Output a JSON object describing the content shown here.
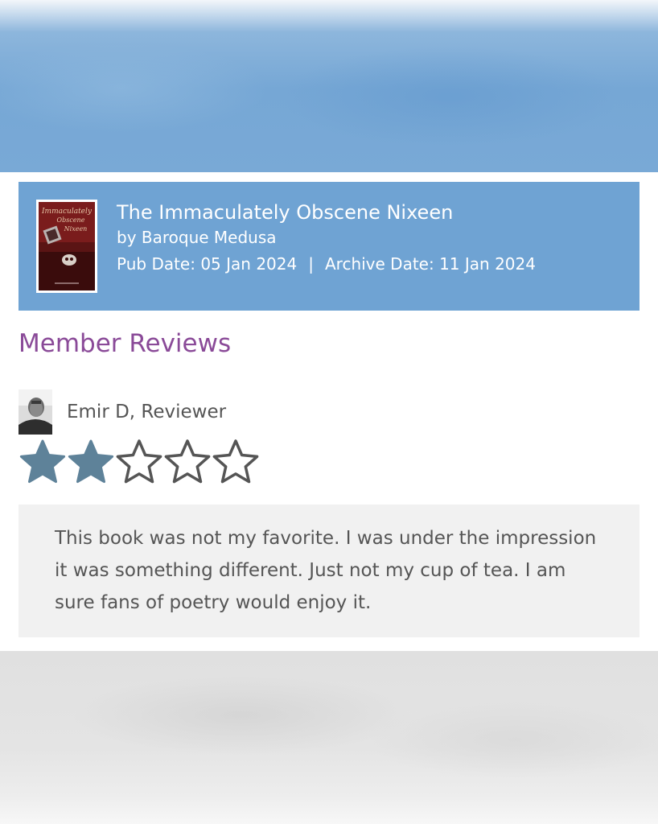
{
  "book": {
    "title": "The Immaculately Obscene Nixeen",
    "author": "by Baroque Medusa",
    "pub_date": "Pub Date: 05 Jan 2024",
    "separator": "|",
    "archive_date": "Archive Date: 11 Jan 2024",
    "cover_text": [
      "Immaculately",
      "Obscene",
      "Nixeen"
    ]
  },
  "section": {
    "title": "Member Reviews"
  },
  "review": {
    "reviewer": "Emir D, Reviewer",
    "rating": 2,
    "rating_max": 5,
    "text": "This book was not my favorite. I was under the impression it was something different. Just not my cup of tea. I am sure fans of poetry would enjoy it."
  },
  "colors": {
    "card_background": "#6fa3d3",
    "section_title": "#8a4a98",
    "star_filled": "#5e8299",
    "star_empty_outline": "#555555",
    "review_background": "#f1f1f1"
  },
  "icons": {
    "star_filled": "star-filled-icon",
    "star_empty": "star-outline-icon"
  }
}
